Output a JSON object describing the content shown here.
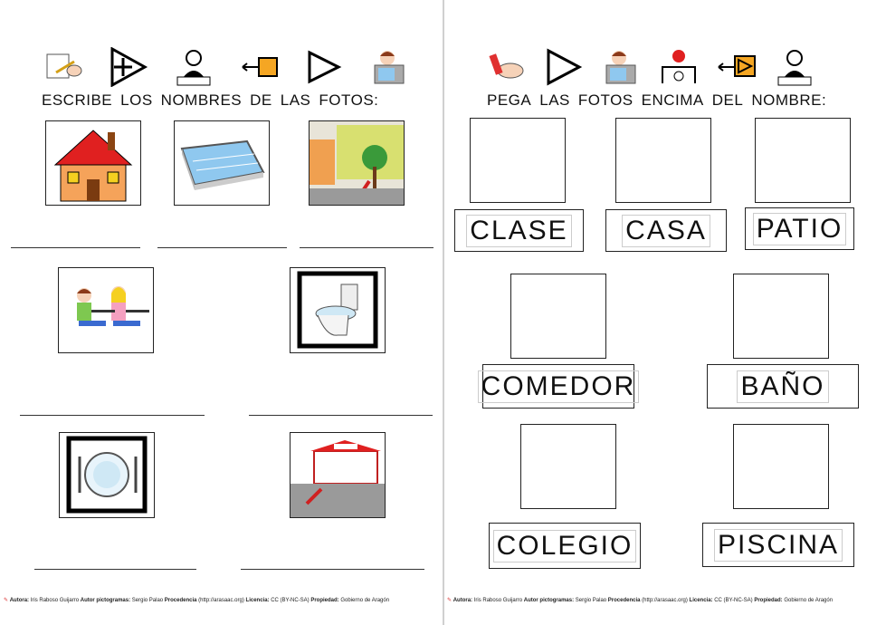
{
  "left": {
    "instruction": [
      "ESCRIBE",
      "LOS",
      "NOMBRES",
      "DE",
      "LAS",
      "FOTOS:"
    ],
    "icons": [
      "writing-hand-icon",
      "plus-triangle-icon",
      "person-name-icon",
      "arrow-square-icon",
      "triangle-icon",
      "photo-camera-icon"
    ],
    "pictures": [
      "house",
      "swimming-pool",
      "patio",
      "classroom",
      "toilet",
      "dining-plate",
      "school"
    ]
  },
  "right": {
    "instruction": [
      "PEGA",
      "LAS",
      "FOTOS",
      "ENCIMA",
      "DEL",
      "NOMBRE:"
    ],
    "icons": [
      "glue-hands-icon",
      "triangle-icon",
      "photo-camera-icon",
      "on-top-icon",
      "arrow-square-icon",
      "person-name-icon"
    ],
    "labels": [
      "CLASE",
      "CASA",
      "PATIO",
      "COMEDOR",
      "BAÑO",
      "COLEGIO",
      "PISCINA"
    ]
  },
  "footer": {
    "autora_label": "Autora:",
    "autora": "Iris Raboso Guijarro",
    "autor_label": "Autor pictogramas:",
    "autor": "Sergio Palao",
    "procedencia_label": "Procedencia",
    "procedencia": "(http://arasaac.org)",
    "licencia_label": "Licencia:",
    "licencia": "CC (BY-NC-SA)",
    "propiedad_label": "Propiedad:",
    "propiedad": "Gobierno de Aragón"
  },
  "colors": {
    "accent_orange": "#f5a623",
    "roof_red": "#e02020",
    "pool_blue": "#8fc8ef"
  }
}
